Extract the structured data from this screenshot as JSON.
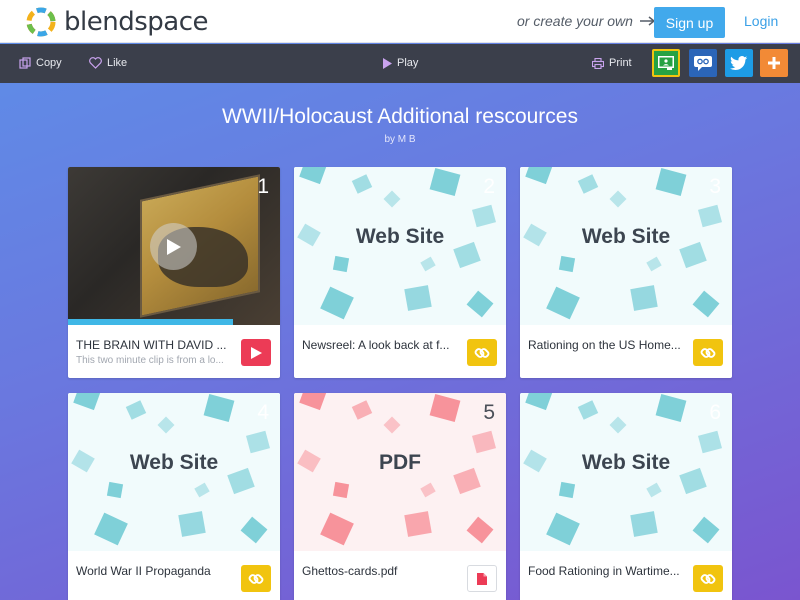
{
  "header": {
    "logo_text": "blendspace",
    "create_text": "or create your own",
    "signup_label": "Sign up",
    "login_label": "Login"
  },
  "toolbar": {
    "copy_label": "Copy",
    "like_label": "Like",
    "play_label": "Play",
    "print_label": "Print",
    "share_buttons": [
      {
        "icon": "google-classroom-icon",
        "color": "#27a243"
      },
      {
        "icon": "remind-icon",
        "color": "#2b65b8"
      },
      {
        "icon": "twitter-icon",
        "color": "#1d9ce6"
      },
      {
        "icon": "plus-icon",
        "color": "#f28a36"
      }
    ]
  },
  "lesson": {
    "title": "WWII/Holocaust Additional rescources",
    "byline": "by M B"
  },
  "cards": [
    {
      "number": "1",
      "type": "video",
      "title": "THE BRAIN WITH DAVID ...",
      "description": "This two minute clip is from a lo..."
    },
    {
      "number": "2",
      "type": "link",
      "thumb_label": "Web Site",
      "title": "Newsreel: A look back at f..."
    },
    {
      "number": "3",
      "type": "link",
      "thumb_label": "Web Site",
      "title": "Rationing on the US Home..."
    },
    {
      "number": "4",
      "type": "link",
      "thumb_label": "Web Site",
      "title": "World War II Propaganda"
    },
    {
      "number": "5",
      "type": "pdf",
      "thumb_label": "PDF",
      "title": "Ghettos-cards.pdf"
    },
    {
      "number": "6",
      "type": "link",
      "thumb_label": "Web Site",
      "title": "Food Rationing in Wartime..."
    }
  ],
  "colors": {
    "accent_blue": "#41a9ec",
    "link_badge": "#f1c40f",
    "video_badge": "#ec3b56",
    "website_pattern": "#7fd0d8",
    "pdf_pattern": "#f7939b"
  }
}
